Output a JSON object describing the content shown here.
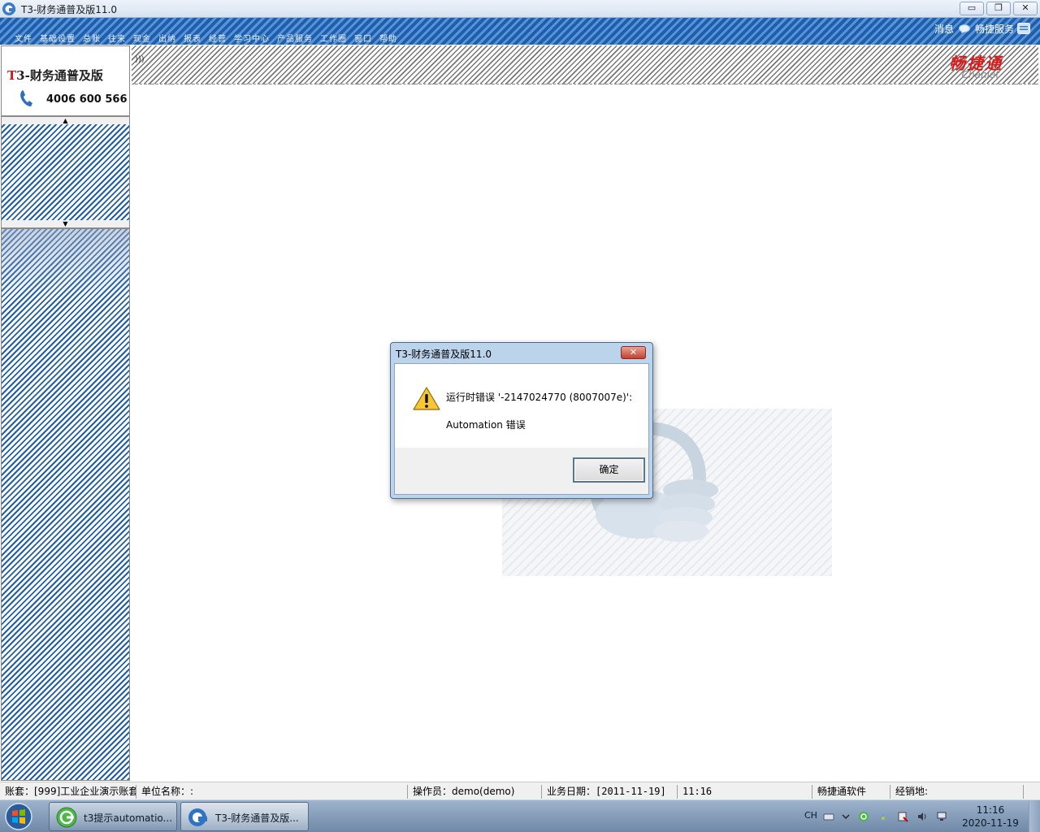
{
  "window": {
    "title": "T3-财务通普及版11.0"
  },
  "menu": {
    "items": [
      "文件",
      "基础设置",
      "总账",
      "往来",
      "现金",
      "出纳",
      "报表",
      "经营",
      "学习中心",
      "产品服务",
      "工作圈",
      "窗口",
      "帮助"
    ],
    "right_links": {
      "messages": "消息",
      "service": "畅捷服务"
    }
  },
  "logo_panel": {
    "brand_t": "T",
    "brand_rest": "3-财务通普及版",
    "phone": "4006 600 566"
  },
  "header_logo": {
    "cn": "畅捷通",
    "en": "Chanjet"
  },
  "dialog": {
    "title": "T3-财务通普及版11.0",
    "message_line1": "运行时错误 '-2147024770 (8007007e)':",
    "message_line2": "Automation 错误",
    "ok_label": "确定"
  },
  "statusbar": {
    "account": "账套：[999]工业企业演示账套",
    "unit": "单位名称：:",
    "operator": "操作员：demo(demo)",
    "business_date": "业务日期：[2011-11-19]",
    "time": "11:16",
    "vendor": "畅捷通软件",
    "dealer": "经销地:"
  },
  "taskbar": {
    "tasks": [
      {
        "label": "t3提示automatio..."
      },
      {
        "label": "T3-财务通普及版..."
      }
    ],
    "tray": {
      "lang": "CH"
    },
    "clock_time": "11:16",
    "clock_date": "2020-11-19"
  }
}
